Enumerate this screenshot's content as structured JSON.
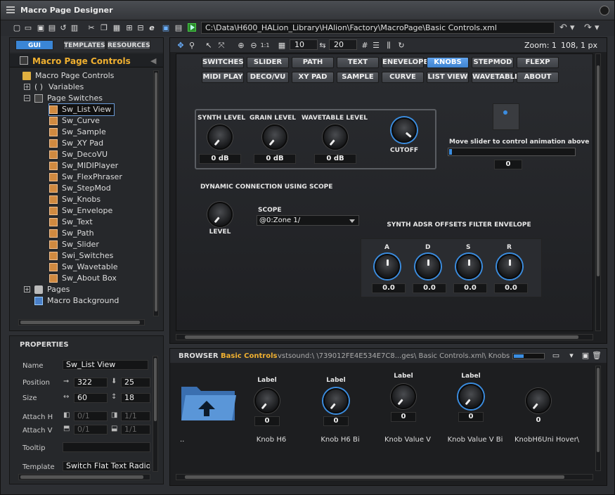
{
  "window": {
    "title": "Macro Page Designer"
  },
  "toolbar": {
    "path": "C:\\Data\\H600_HALion_Library\\HAlion\\Factory\\MacroPage\\Basic Controls.xml"
  },
  "left_panel": {
    "tabs": [
      "GUI",
      "TEMPLATES",
      "RESOURCES"
    ],
    "header": "Macro Page Controls",
    "tree": [
      {
        "label": "Macro Page Controls",
        "level": 0,
        "type": "folder"
      },
      {
        "label": "Variables",
        "level": 1,
        "type": "vars",
        "expander": "+"
      },
      {
        "label": "Page Switches",
        "level": 1,
        "type": "switches",
        "expander": "−"
      },
      {
        "label": "Sw_List View",
        "level": 2,
        "type": "sw",
        "selected": true
      },
      {
        "label": "Sw_Curve",
        "level": 2,
        "type": "sw"
      },
      {
        "label": "Sw_Sample",
        "level": 2,
        "type": "sw"
      },
      {
        "label": "Sw_XY Pad",
        "level": 2,
        "type": "sw"
      },
      {
        "label": "Sw_DecoVU",
        "level": 2,
        "type": "sw"
      },
      {
        "label": "Sw_MIDIPlayer",
        "level": 2,
        "type": "sw"
      },
      {
        "label": "Sw_FlexPhraser",
        "level": 2,
        "type": "sw"
      },
      {
        "label": "Sw_StepMod",
        "level": 2,
        "type": "sw"
      },
      {
        "label": "Sw_Knobs",
        "level": 2,
        "type": "sw"
      },
      {
        "label": "Sw_Envelope",
        "level": 2,
        "type": "sw"
      },
      {
        "label": "Sw_Text",
        "level": 2,
        "type": "sw"
      },
      {
        "label": "Sw_Path",
        "level": 2,
        "type": "sw"
      },
      {
        "label": "Sw_Slider",
        "level": 2,
        "type": "sw"
      },
      {
        "label": "Swi_Switches",
        "level": 2,
        "type": "sw"
      },
      {
        "label": "Sw_Wavetable",
        "level": 2,
        "type": "sw"
      },
      {
        "label": "Sw_About Box",
        "level": 2,
        "type": "sw"
      },
      {
        "label": "Pages",
        "level": 1,
        "type": "pages",
        "expander": "+"
      },
      {
        "label": "Macro Background",
        "level": 1,
        "type": "image"
      }
    ]
  },
  "properties": {
    "title": "PROPERTIES",
    "name_label": "Name",
    "name_value": "Sw_List View",
    "position_label": "Position",
    "pos_x": "322",
    "pos_y": "25",
    "size_label": "Size",
    "size_w": "60",
    "size_h": "18",
    "attach_h_label": "Attach H",
    "attach_h_a": "0/1",
    "attach_h_b": "1/1",
    "attach_v_label": "Attach V",
    "attach_v_a": "0/1",
    "attach_v_b": "1/1",
    "tooltip_label": "Tooltip",
    "tooltip_value": "",
    "template_label": "Template",
    "template_value": "Switch Flat Text Radio"
  },
  "canvas": {
    "grid_x": "10",
    "grid_y": "20",
    "zoom": "Zoom: 1",
    "coords": "108, 1 px",
    "switch_row1": [
      "SWITCHES",
      "SLIDER",
      "PATH",
      "TEXT",
      "ENEVELOPE",
      "KNOBS",
      "STEPMOD",
      "FLEXP"
    ],
    "switch_row2": [
      "MIDI PLAY",
      "DECO/VU",
      "XY PAD",
      "SAMPLE",
      "CURVE",
      "LIST VIEW",
      "WAVETABLE",
      "ABOUT"
    ],
    "active_switch": "KNOBS",
    "knobs": [
      {
        "label": "SYNTH LEVEL",
        "value": "0 dB"
      },
      {
        "label": "GRAIN LEVEL",
        "value": "0 dB"
      },
      {
        "label": "WAVETABLE LEVEL",
        "value": "0 dB"
      },
      {
        "label": "CUTOFF",
        "value": ""
      }
    ],
    "slider_caption": "Move slider to control animation above",
    "slider_value": "0",
    "dyn_title": "DYNAMIC CONNECTION USING SCOPE",
    "level_label": "LEVEL",
    "scope_label": "SCOPE",
    "scope_value": "@0:Zone 1/",
    "adsr_title": "SYNTH ADSR OFFSETS FILTER ENVELOPE",
    "adsr": [
      {
        "label": "A",
        "value": "0.0"
      },
      {
        "label": "D",
        "value": "0.0"
      },
      {
        "label": "S",
        "value": "0.0"
      },
      {
        "label": "R",
        "value": "0.0"
      }
    ]
  },
  "browser": {
    "title": "BROWSER",
    "name": "Basic Controls",
    "path": "vstsound:\\ \\739012FE4E534E7C8...ges\\ Basic Controls.xml\\ Knobs",
    "items": [
      {
        "caption": "..",
        "label": "",
        "value": ""
      },
      {
        "caption": "Knob H6",
        "label": "Label",
        "value": "0"
      },
      {
        "caption": "Knob H6 Bi",
        "label": "Label",
        "value": "0"
      },
      {
        "caption": "Knob Value V",
        "label": "Label",
        "value": "0"
      },
      {
        "caption": "Knob Value V Bi",
        "label": "Label",
        "value": "0"
      },
      {
        "caption": "KnobH6Uni Hover\\",
        "label": "",
        "value": "0"
      }
    ]
  }
}
